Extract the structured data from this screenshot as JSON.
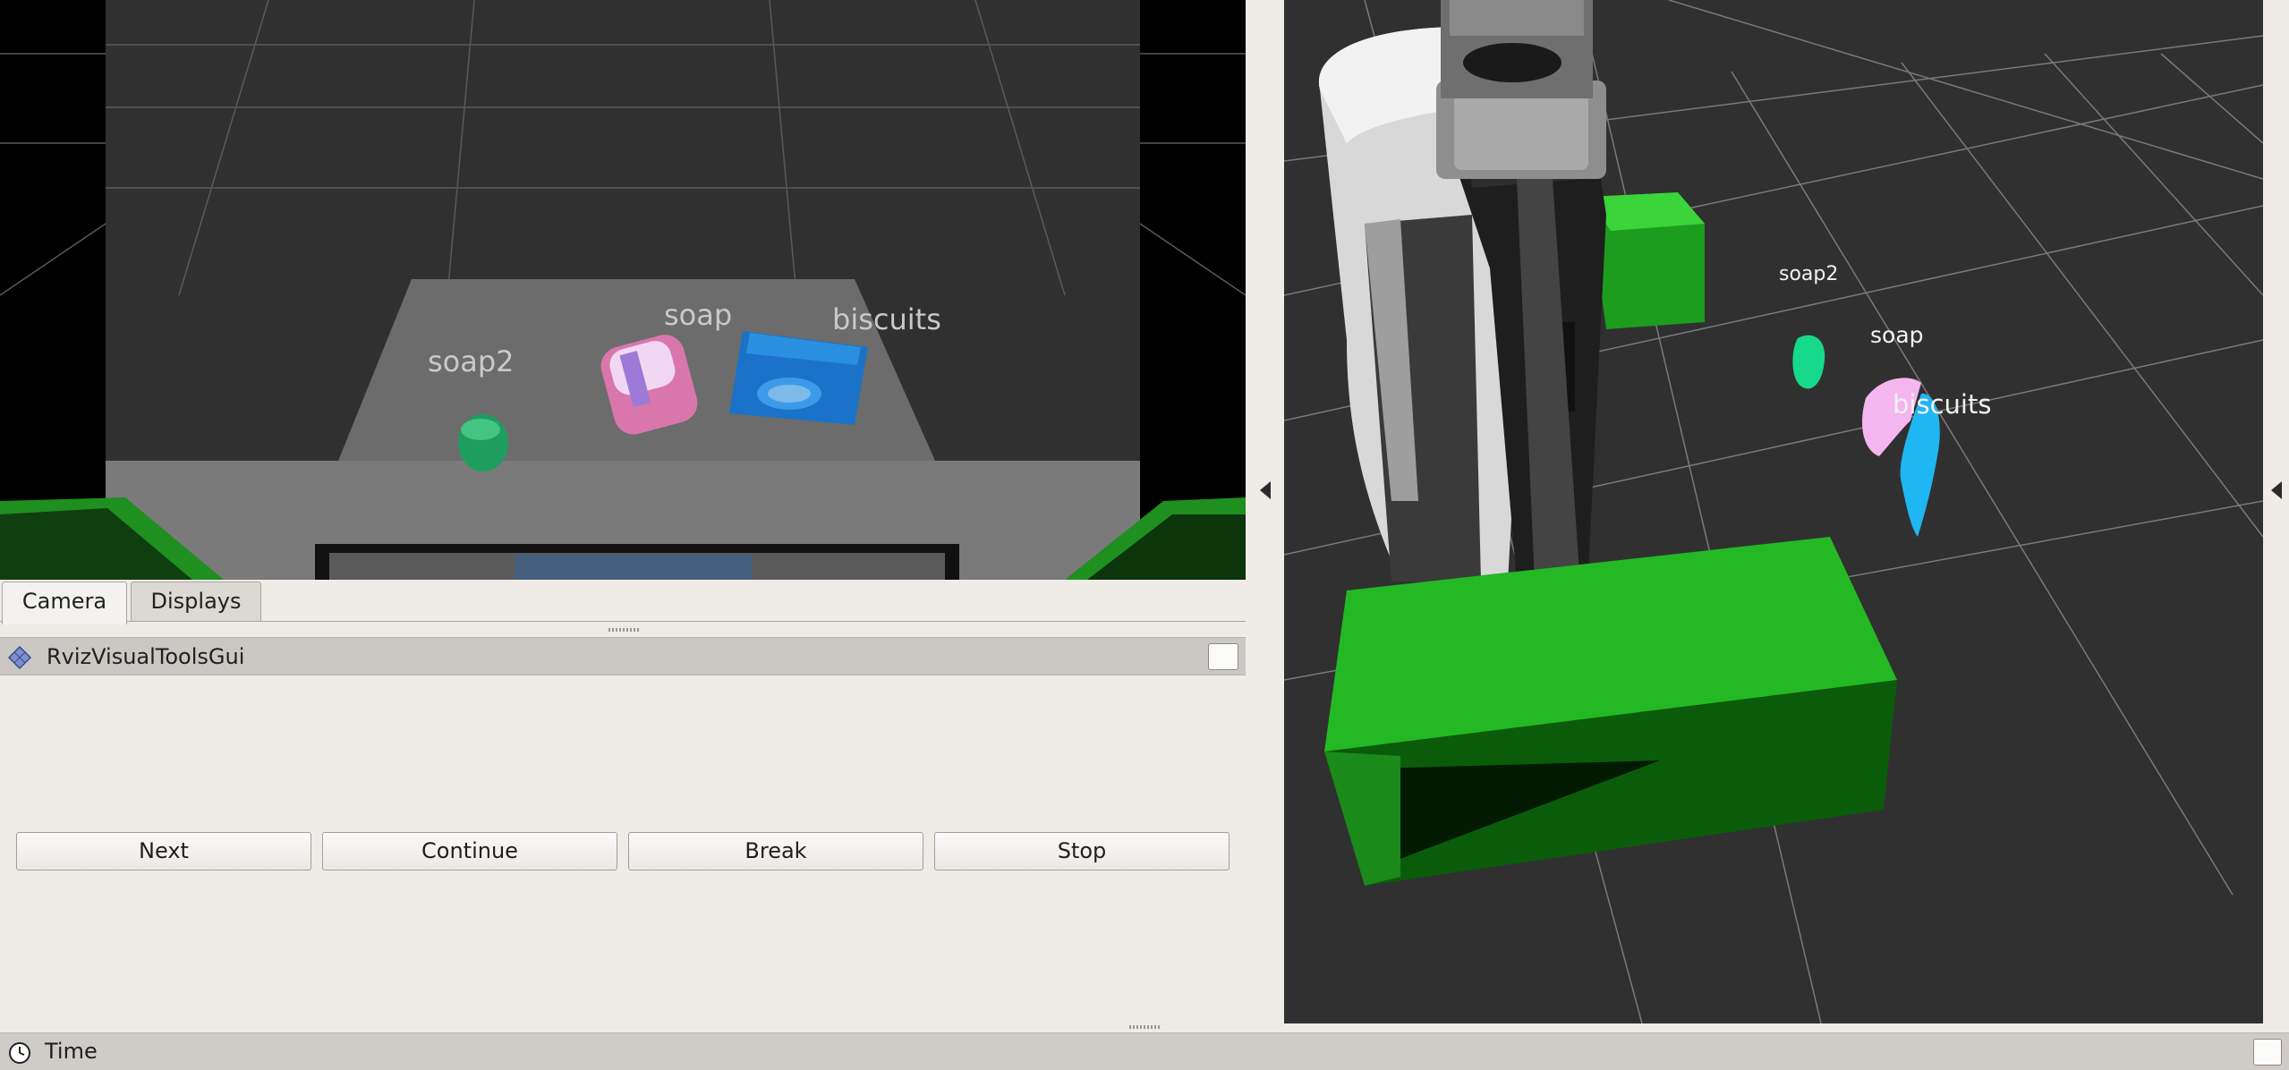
{
  "camera_view": {
    "labels": {
      "soap2": "soap2",
      "soap": "soap",
      "biscuits": "biscuits"
    }
  },
  "tabs": [
    {
      "label": "Camera",
      "active": true
    },
    {
      "label": "Displays",
      "active": false
    }
  ],
  "panel": {
    "title": "RvizVisualToolsGui",
    "icon": "panel-diamond-icon"
  },
  "buttons": {
    "next": "Next",
    "continue": "Continue",
    "break": "Break",
    "stop": "Stop"
  },
  "view3d": {
    "labels": {
      "soap2": "soap2",
      "soap": "soap",
      "biscuits": "biscuits"
    }
  },
  "time_panel": {
    "label": "Time",
    "icon": "clock-icon"
  },
  "colors": {
    "background": "#efebe7",
    "grid_bg": "#303030",
    "table_green": "#1fa11f",
    "soap2": "#17d98a",
    "soap": "#f4b6ee",
    "biscuits": "#1fb6f4"
  }
}
